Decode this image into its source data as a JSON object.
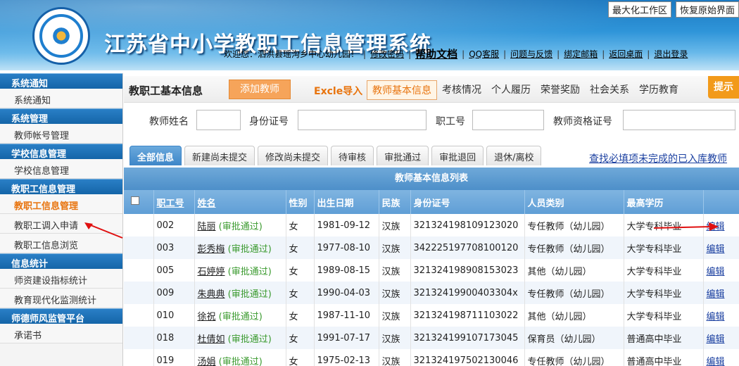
{
  "header": {
    "title": "江苏省中小学教职工信息管理系统",
    "top_buttons": [
      "最大化工作区",
      "恢复原始界面"
    ],
    "welcome": "欢迎您：泗洪县瑶沟乡中心幼儿园！",
    "links": [
      "修改密码",
      "帮助文档",
      "QQ客服",
      "问题与反馈",
      "绑定邮箱",
      "返回桌面",
      "退出登录"
    ]
  },
  "sidebar": {
    "sections": [
      {
        "title": "系统通知",
        "items": [
          "系统通知"
        ]
      },
      {
        "title": "系统管理",
        "items": [
          "教师帐号管理"
        ]
      },
      {
        "title": "学校信息管理",
        "items": [
          "学校信息管理"
        ]
      },
      {
        "title": "教职工信息管理",
        "items": [
          "教职工信息管理",
          "教职工调入申请",
          "教职工信息浏览"
        ]
      },
      {
        "title": "信息统计",
        "items": [
          "师资建设指标统计",
          "教育现代化监测统计"
        ]
      },
      {
        "title": "师德师风监管平台",
        "items": [
          "承诺书"
        ]
      }
    ],
    "active_item": "教职工信息管理"
  },
  "main": {
    "page_title": "教职工基本信息",
    "add_button": "添加教师",
    "excel_import": "Excle导入",
    "nav_tabs": [
      "教师基本信息",
      "考核情况",
      "个人履历",
      "荣誉奖励",
      "社会关系",
      "学历教育"
    ],
    "tip_button": "提示",
    "filters": [
      {
        "label": "教师姓名",
        "value": ""
      },
      {
        "label": "身份证号",
        "value": ""
      },
      {
        "label": "职工号",
        "value": ""
      },
      {
        "label": "教师资格证号",
        "value": ""
      }
    ],
    "sub_tabs": [
      "全部信息",
      "新建尚未提交",
      "修改尚未提交",
      "待审核",
      "审批通过",
      "审批退回",
      "退休/离校"
    ],
    "find_link": "查找必填项未完成的已入库教师",
    "table_title": "教师基本信息列表",
    "columns": [
      "职工号",
      "姓名",
      "性别",
      "出生日期",
      "民族",
      "身份证号",
      "人员类别",
      "最高学历",
      ""
    ],
    "rows": [
      {
        "id": "002",
        "name": "陆丽",
        "status": "(审批通过)",
        "gender": "女",
        "birth": "1981-09-12",
        "ethnic": "汉族",
        "idno": "321324198109123020",
        "category": "专任教师（幼儿园）",
        "edu": "大学专科毕业",
        "action": "编辑"
      },
      {
        "id": "003",
        "name": "彭秀梅",
        "status": "(审批通过)",
        "gender": "女",
        "birth": "1977-08-10",
        "ethnic": "汉族",
        "idno": "342225197708100120",
        "category": "专任教师（幼儿园）",
        "edu": "大学专科毕业",
        "action": "编辑"
      },
      {
        "id": "005",
        "name": "石婷婷",
        "status": "(审批通过)",
        "gender": "女",
        "birth": "1989-08-15",
        "ethnic": "汉族",
        "idno": "321324198908153023",
        "category": "其他（幼儿园）",
        "edu": "大学专科毕业",
        "action": "编辑"
      },
      {
        "id": "009",
        "name": "朱典典",
        "status": "(审批通过)",
        "gender": "女",
        "birth": "1990-04-03",
        "ethnic": "汉族",
        "idno": "32132419900403304x",
        "category": "专任教师（幼儿园）",
        "edu": "大学专科毕业",
        "action": "编辑"
      },
      {
        "id": "010",
        "name": "徐祝",
        "status": "(审批通过)",
        "gender": "女",
        "birth": "1987-11-10",
        "ethnic": "汉族",
        "idno": "321324198711103022",
        "category": "其他（幼儿园）",
        "edu": "大学专科毕业",
        "action": "编辑"
      },
      {
        "id": "018",
        "name": "杜倩如",
        "status": "(审批通过)",
        "gender": "女",
        "birth": "1991-07-17",
        "ethnic": "汉族",
        "idno": "321324199107173045",
        "category": "保育员（幼儿园）",
        "edu": "普通高中毕业",
        "action": "编辑"
      },
      {
        "id": "019",
        "name": "汤娟",
        "status": "(审批通过)",
        "gender": "女",
        "birth": "1975-02-13",
        "ethnic": "汉族",
        "idno": "321324197502130046",
        "category": "专任教师（幼儿园）",
        "edu": "普通高中毕业",
        "action": "编辑"
      }
    ]
  }
}
